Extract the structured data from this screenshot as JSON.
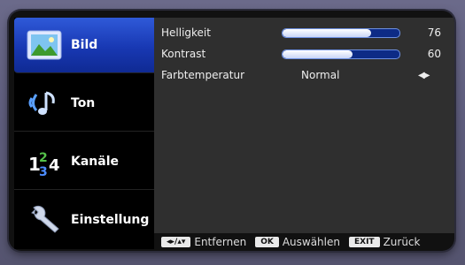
{
  "sidebar": {
    "items": [
      {
        "label": "Bild",
        "icon": "picture-icon",
        "active": true
      },
      {
        "label": "Ton",
        "icon": "speaker-note-icon",
        "active": false
      },
      {
        "label": "Kanäle",
        "icon": "channel-numbers-icon",
        "active": false
      },
      {
        "label": "Einstellung",
        "icon": "wrench-icon",
        "active": false
      }
    ]
  },
  "settings": {
    "brightness": {
      "label": "Helligkeit",
      "value": "76",
      "fraction": 0.76
    },
    "contrast": {
      "label": "Kontrast",
      "value": "60",
      "fraction": 0.6
    },
    "color_temp": {
      "label": "Farbtemperatur",
      "value": "Normal",
      "arrows": "◀▶"
    }
  },
  "footer": {
    "remove_key": "◂▸/▴▾",
    "remove_label": "Entfernen",
    "ok_key": "OK",
    "ok_label": "Auswählen",
    "exit_key": "EXIT",
    "exit_label": "Zurück"
  },
  "colors": {
    "accent": "#1f46c6",
    "bar_bg": "#0d2b86"
  }
}
